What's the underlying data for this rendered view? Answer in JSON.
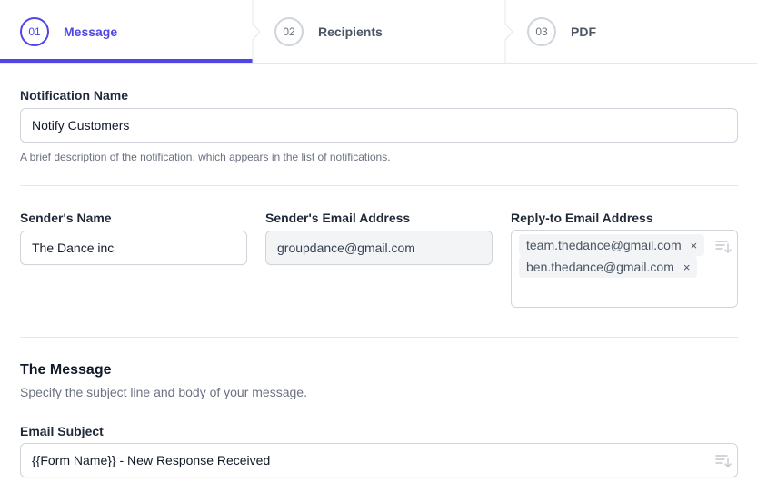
{
  "steps": [
    {
      "number": "01",
      "label": "Message",
      "active": true
    },
    {
      "number": "02",
      "label": "Recipients",
      "active": false
    },
    {
      "number": "03",
      "label": "PDF",
      "active": false
    }
  ],
  "notification": {
    "label": "Notification Name",
    "value": "Notify Customers",
    "hint": "A brief description of the notification, which appears in the list of notifications."
  },
  "sender_name": {
    "label": "Sender's Name",
    "value": "The Dance inc"
  },
  "sender_email": {
    "label": "Sender's Email Address",
    "value": "groupdance@gmail.com"
  },
  "reply_to": {
    "label": "Reply-to Email Address",
    "tags": [
      "team.thedance@gmail.com",
      "ben.thedance@gmail.com"
    ],
    "remove_glyph": "×"
  },
  "message_section": {
    "title": "The Message",
    "subtitle": "Specify the subject line and body of your message."
  },
  "email_subject": {
    "label": "Email Subject",
    "value": "{{Form Name}} - New Response Received"
  },
  "colors": {
    "accent": "#5046e5",
    "border": "#d1d5db",
    "muted": "#6b7280"
  },
  "icons": {
    "merge_tag": "sort-lines-icon",
    "step_separator": "chevron-right-icon",
    "remove": "close-icon"
  }
}
